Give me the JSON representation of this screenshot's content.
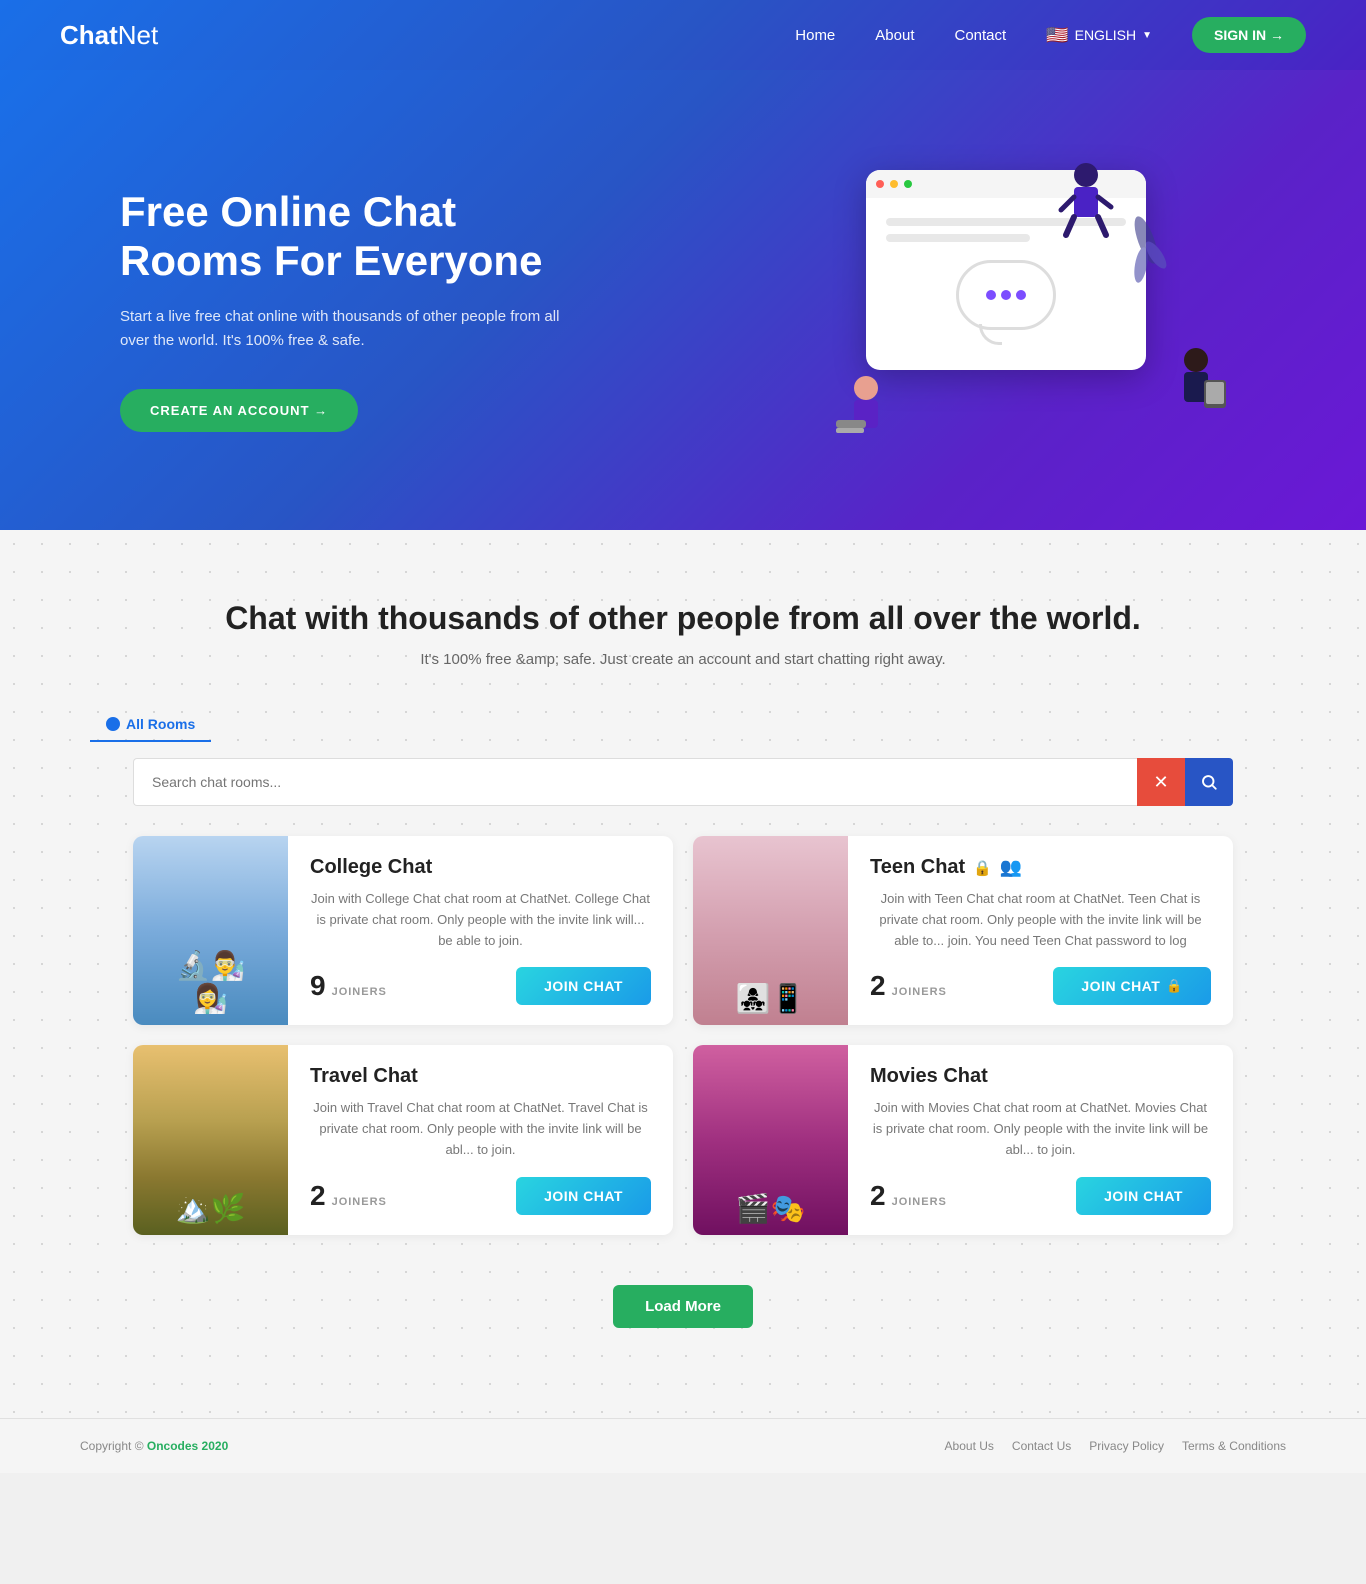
{
  "nav": {
    "logo_chat": "Chat",
    "logo_net": "Net",
    "links": [
      {
        "label": "Home",
        "id": "nav-home"
      },
      {
        "label": "About",
        "id": "nav-about"
      },
      {
        "label": "Contact",
        "id": "nav-contact"
      }
    ],
    "lang_label": "ENGLISH",
    "signin_label": "SIGN IN →"
  },
  "hero": {
    "title": "Free Online Chat Rooms For Everyone",
    "subtitle": "Start a live free chat online with thousands of other people from all over the world. It's 100% free & safe.",
    "cta_label": "CREATE AN ACCOUNT →"
  },
  "section": {
    "title": "Chat with thousands of other people from all over the world.",
    "subtitle": "It's 100% free &amp; safe. Just create an account and start chatting right away.",
    "tab_label": "All Rooms",
    "search_placeholder": "Search chat rooms...",
    "search_clear": "✕",
    "search_go": "🔍"
  },
  "rooms": [
    {
      "id": "college",
      "name": "College Chat",
      "img_class": "college",
      "desc": "Join with College Chat chat room at ChatNet. College Chat is private chat room. Only people with the invite link will... be able to join.",
      "joiners": 9,
      "joiners_label": "JOINERS",
      "btn_label": "JOIN CHAT",
      "locked": false
    },
    {
      "id": "teen",
      "name": "Teen Chat",
      "img_class": "teen",
      "desc": "Join with Teen Chat chat room at ChatNet. Teen Chat is private chat room. Only people with the invite link will be able to... join. You need Teen Chat password to log",
      "joiners": 2,
      "joiners_label": "JOINERS",
      "btn_label": "JOIN CHAT",
      "locked": true
    },
    {
      "id": "travel",
      "name": "Travel Chat",
      "img_class": "travel",
      "desc": "Join with Travel Chat chat room at ChatNet. Travel Chat is private chat room. Only people with the invite link will be abl... to join.",
      "joiners": 2,
      "joiners_label": "JOINERS",
      "btn_label": "JOIN CHAT",
      "locked": false
    },
    {
      "id": "movies",
      "name": "Movies Chat",
      "img_class": "movies",
      "desc": "Join with Movies Chat chat room at ChatNet. Movies Chat is private chat room. Only people with the invite link will be abl... to join.",
      "joiners": 2,
      "joiners_label": "JOINERS",
      "btn_label": "JOIN CHAT",
      "locked": false
    }
  ],
  "load_more": "Load More",
  "footer": {
    "copy": "Copyright © Oncodes 2020",
    "links": [
      {
        "label": "About Us"
      },
      {
        "label": "Contact Us"
      },
      {
        "label": "Privacy Policy"
      },
      {
        "label": "Terms & Conditions"
      }
    ]
  }
}
